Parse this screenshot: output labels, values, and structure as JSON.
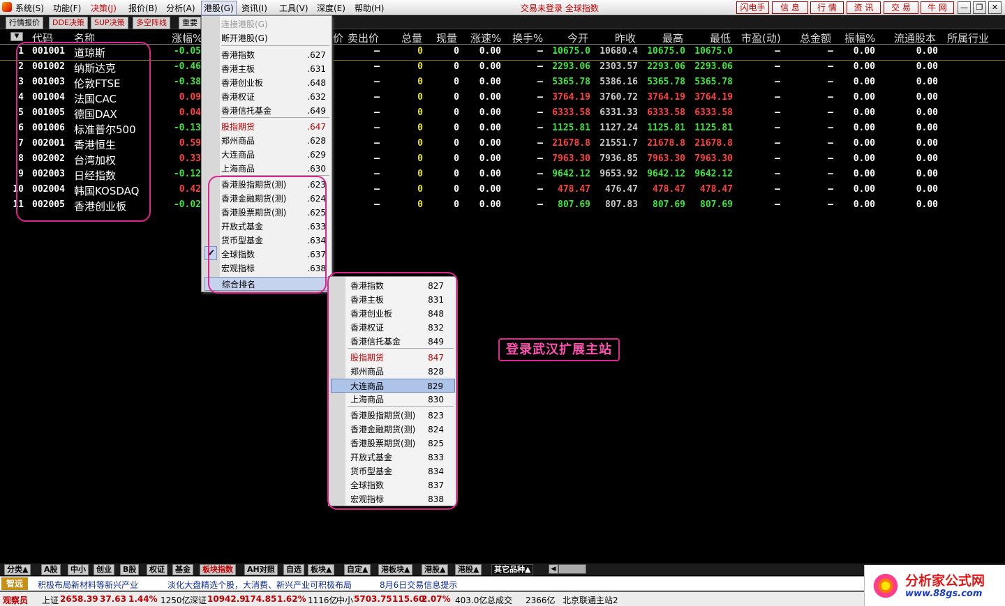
{
  "menubar": {
    "items": [
      "系统(S)",
      "功能(F)",
      "决策(J)",
      "报价(B)",
      "分析(A)",
      "港股(G)",
      "资讯(I)",
      "工具(V)",
      "深度(E)",
      "帮助(H)"
    ],
    "login_status": "交易未登录 全球指数",
    "right_buttons": [
      "闪电手",
      "信 息",
      "行 情",
      "资 讯",
      "交 易",
      "牛 网"
    ]
  },
  "tabs": [
    "行情报价",
    "DDE决策",
    "SUP决策",
    "多空阵线",
    "重要"
  ],
  "table": {
    "headers": [
      "代码",
      "名称",
      "涨幅%",
      "价",
      "卖出价",
      "总量",
      "现量",
      "涨速%",
      "换手%",
      "今开",
      "昨收",
      "最高",
      "最低",
      "市盈(动)",
      "总金额",
      "振幅%",
      "流通股本",
      "所属行业"
    ],
    "rows": [
      {
        "n": "1",
        "code": "001001",
        "name": "道琼斯",
        "chg": "-0.05",
        "sell": "—",
        "vol": "0",
        "cur": "0",
        "spd": "0.00",
        "turn": "—",
        "open": "10675.0",
        "prev": "10680.4",
        "high": "10675.0",
        "low": "10675.0",
        "pe": "—",
        "amt": "—",
        "amp": "0.00",
        "float": "0.00",
        "dir": "g"
      },
      {
        "n": "2",
        "code": "001002",
        "name": "纳斯达克",
        "chg": "-0.46",
        "sell": "—",
        "vol": "0",
        "cur": "0",
        "spd": "0.00",
        "turn": "—",
        "open": "2293.06",
        "prev": "2303.57",
        "high": "2293.06",
        "low": "2293.06",
        "pe": "—",
        "amt": "—",
        "amp": "0.00",
        "float": "0.00",
        "dir": "g"
      },
      {
        "n": "3",
        "code": "001003",
        "name": "伦敦FTSE",
        "chg": "-0.38",
        "sell": "—",
        "vol": "0",
        "cur": "0",
        "spd": "0.00",
        "turn": "—",
        "open": "5365.78",
        "prev": "5386.16",
        "high": "5365.78",
        "low": "5365.78",
        "pe": "—",
        "amt": "—",
        "amp": "0.00",
        "float": "0.00",
        "dir": "g"
      },
      {
        "n": "4",
        "code": "001004",
        "name": "法国CAC",
        "chg": "0.09",
        "sell": "—",
        "vol": "0",
        "cur": "0",
        "spd": "0.00",
        "turn": "—",
        "open": "3764.19",
        "prev": "3760.72",
        "high": "3764.19",
        "low": "3764.19",
        "pe": "—",
        "amt": "—",
        "amp": "0.00",
        "float": "0.00",
        "dir": "r"
      },
      {
        "n": "5",
        "code": "001005",
        "name": "德国DAX",
        "chg": "0.04",
        "sell": "—",
        "vol": "0",
        "cur": "0",
        "spd": "0.00",
        "turn": "—",
        "open": "6333.58",
        "prev": "6331.33",
        "high": "6333.58",
        "low": "6333.58",
        "pe": "—",
        "amt": "—",
        "amp": "0.00",
        "float": "0.00",
        "dir": "r"
      },
      {
        "n": "6",
        "code": "001006",
        "name": "标准普尔500",
        "chg": "-0.13",
        "sell": "—",
        "vol": "0",
        "cur": "0",
        "spd": "0.00",
        "turn": "—",
        "open": "1125.81",
        "prev": "1127.24",
        "high": "1125.81",
        "low": "1125.81",
        "pe": "—",
        "amt": "—",
        "amp": "0.00",
        "float": "0.00",
        "dir": "g"
      },
      {
        "n": "7",
        "code": "002001",
        "name": "香港恒生",
        "chg": "0.59",
        "sell": "—",
        "vol": "0",
        "cur": "0",
        "spd": "0.00",
        "turn": "—",
        "open": "21678.8",
        "prev": "21551.7",
        "high": "21678.8",
        "low": "21678.8",
        "pe": "—",
        "amt": "—",
        "amp": "0.00",
        "float": "0.00",
        "dir": "r"
      },
      {
        "n": "8",
        "code": "002002",
        "name": "台湾加权",
        "chg": "0.33",
        "sell": "—",
        "vol": "0",
        "cur": "0",
        "spd": "0.00",
        "turn": "—",
        "open": "7963.30",
        "prev": "7936.85",
        "high": "7963.30",
        "low": "7963.30",
        "pe": "—",
        "amt": "—",
        "amp": "0.00",
        "float": "0.00",
        "dir": "r"
      },
      {
        "n": "9",
        "code": "002003",
        "name": "日经指数",
        "chg": "-0.12",
        "sell": "—",
        "vol": "0",
        "cur": "0",
        "spd": "0.00",
        "turn": "—",
        "open": "9642.12",
        "prev": "9653.92",
        "high": "9642.12",
        "low": "9642.12",
        "pe": "—",
        "amt": "—",
        "amp": "0.00",
        "float": "0.00",
        "dir": "g"
      },
      {
        "n": "10",
        "code": "002004",
        "name": "韩国KOSDAQ",
        "chg": "0.42",
        "sell": "—",
        "vol": "0",
        "cur": "0",
        "spd": "0.00",
        "turn": "—",
        "open": "478.47",
        "prev": "476.47",
        "high": "478.47",
        "low": "478.47",
        "pe": "—",
        "amt": "—",
        "amp": "0.00",
        "float": "0.00",
        "dir": "r"
      },
      {
        "n": "11",
        "code": "002005",
        "name": "香港创业板",
        "chg": "-0.02",
        "sell": "—",
        "vol": "0",
        "cur": "0",
        "spd": "0.00",
        "turn": "—",
        "open": "807.69",
        "prev": "807.83",
        "high": "807.69",
        "low": "807.69",
        "pe": "—",
        "amt": "—",
        "amp": "0.00",
        "float": "0.00",
        "dir": "g"
      }
    ]
  },
  "menu_hk": {
    "items": [
      {
        "label": "连接港股(G)",
        "key": "",
        "style": "dis"
      },
      {
        "label": "断开港股(G)",
        "key": "",
        "style": ""
      },
      {
        "label": "香港指数",
        "key": ".627",
        "style": ""
      },
      {
        "label": "香港主板",
        "key": ".631",
        "style": ""
      },
      {
        "label": "香港创业板",
        "key": ".648",
        "style": ""
      },
      {
        "label": "香港权证",
        "key": ".632",
        "style": ""
      },
      {
        "label": "香港信托基金",
        "key": ".649",
        "style": ""
      },
      {
        "label": "股指期货",
        "key": ".647",
        "style": "red"
      },
      {
        "label": "郑州商品",
        "key": ".628",
        "style": ""
      },
      {
        "label": "大连商品",
        "key": ".629",
        "style": ""
      },
      {
        "label": "上海商品",
        "key": ".630",
        "style": ""
      },
      {
        "label": "香港股指期货(测)",
        "key": ".623",
        "style": ""
      },
      {
        "label": "香港金融期货(测)",
        "key": ".624",
        "style": ""
      },
      {
        "label": "香港股票期货(测)",
        "key": ".625",
        "style": ""
      },
      {
        "label": "开放式基金",
        "key": ".633",
        "style": ""
      },
      {
        "label": "货币型基金",
        "key": ".634",
        "style": ""
      },
      {
        "label": "全球指数",
        "key": ".637",
        "style": ""
      },
      {
        "label": "宏观指标",
        "key": ".638",
        "style": ""
      },
      {
        "label": "综合排名",
        "key": "",
        "style": ""
      }
    ],
    "checkmark": "✔"
  },
  "submenu": {
    "items": [
      {
        "label": "香港指数",
        "key": "827",
        "style": ""
      },
      {
        "label": "香港主板",
        "key": "831",
        "style": ""
      },
      {
        "label": "香港创业板",
        "key": "848",
        "style": ""
      },
      {
        "label": "香港权证",
        "key": "832",
        "style": ""
      },
      {
        "label": "香港信托基金",
        "key": "849",
        "style": ""
      },
      {
        "label": "股指期货",
        "key": "847",
        "style": "red"
      },
      {
        "label": "郑州商品",
        "key": "828",
        "style": ""
      },
      {
        "label": "大连商品",
        "key": "829",
        "style": ""
      },
      {
        "label": "上海商品",
        "key": "830",
        "style": ""
      },
      {
        "label": "香港股指期货(测)",
        "key": "823",
        "style": ""
      },
      {
        "label": "香港金融期货(测)",
        "key": "824",
        "style": ""
      },
      {
        "label": "香港股票期货(测)",
        "key": "825",
        "style": ""
      },
      {
        "label": "开放式基金",
        "key": "833",
        "style": ""
      },
      {
        "label": "货币型基金",
        "key": "834",
        "style": ""
      },
      {
        "label": "全球指数",
        "key": "837",
        "style": ""
      },
      {
        "label": "宏观指标",
        "key": "838",
        "style": ""
      }
    ]
  },
  "annotation": "登录武汉扩展主站",
  "bottom_tabs": [
    "分类▲",
    "A股",
    "中小",
    "创业",
    "B股",
    "权证",
    "基金",
    "板块指数",
    "AH对照",
    "自选",
    "板块▲",
    "自定▲",
    "港板块▲",
    "港股▲",
    "港股▲",
    "其它品种▲"
  ],
  "news": {
    "badge": "智远",
    "items": [
      "积极布局新材料等新兴产业",
      "淡化大盘精选个股，大消费、新兴产业可积极布局",
      "8月6日交易信息提示"
    ]
  },
  "status": {
    "observer": "观察员",
    "sh_label": "上证",
    "sh_value": "2658.39",
    "sh_chg": "37.63",
    "sh_pct": "1.44%",
    "sh_amt": "1250亿",
    "sz_label": "深证",
    "sz_value": "10942.9",
    "sz_chg": "174.85",
    "sz_pct": "1.62%",
    "sz_amt": "1116亿",
    "zx_label": "中小",
    "zx_value": "5703.75",
    "zx_chg": "115.60",
    "zx_pct": "2.07%",
    "zx_amt": "403.0亿",
    "total_label": "总成交",
    "total_amt": "2366亿",
    "server": "北京联通主站2"
  },
  "watermark": {
    "title": "分析家公式网",
    "url": "www.88gs.com"
  },
  "colors": {
    "up": "#ff4040",
    "down": "#39e639",
    "annotation": "#e0238f"
  }
}
